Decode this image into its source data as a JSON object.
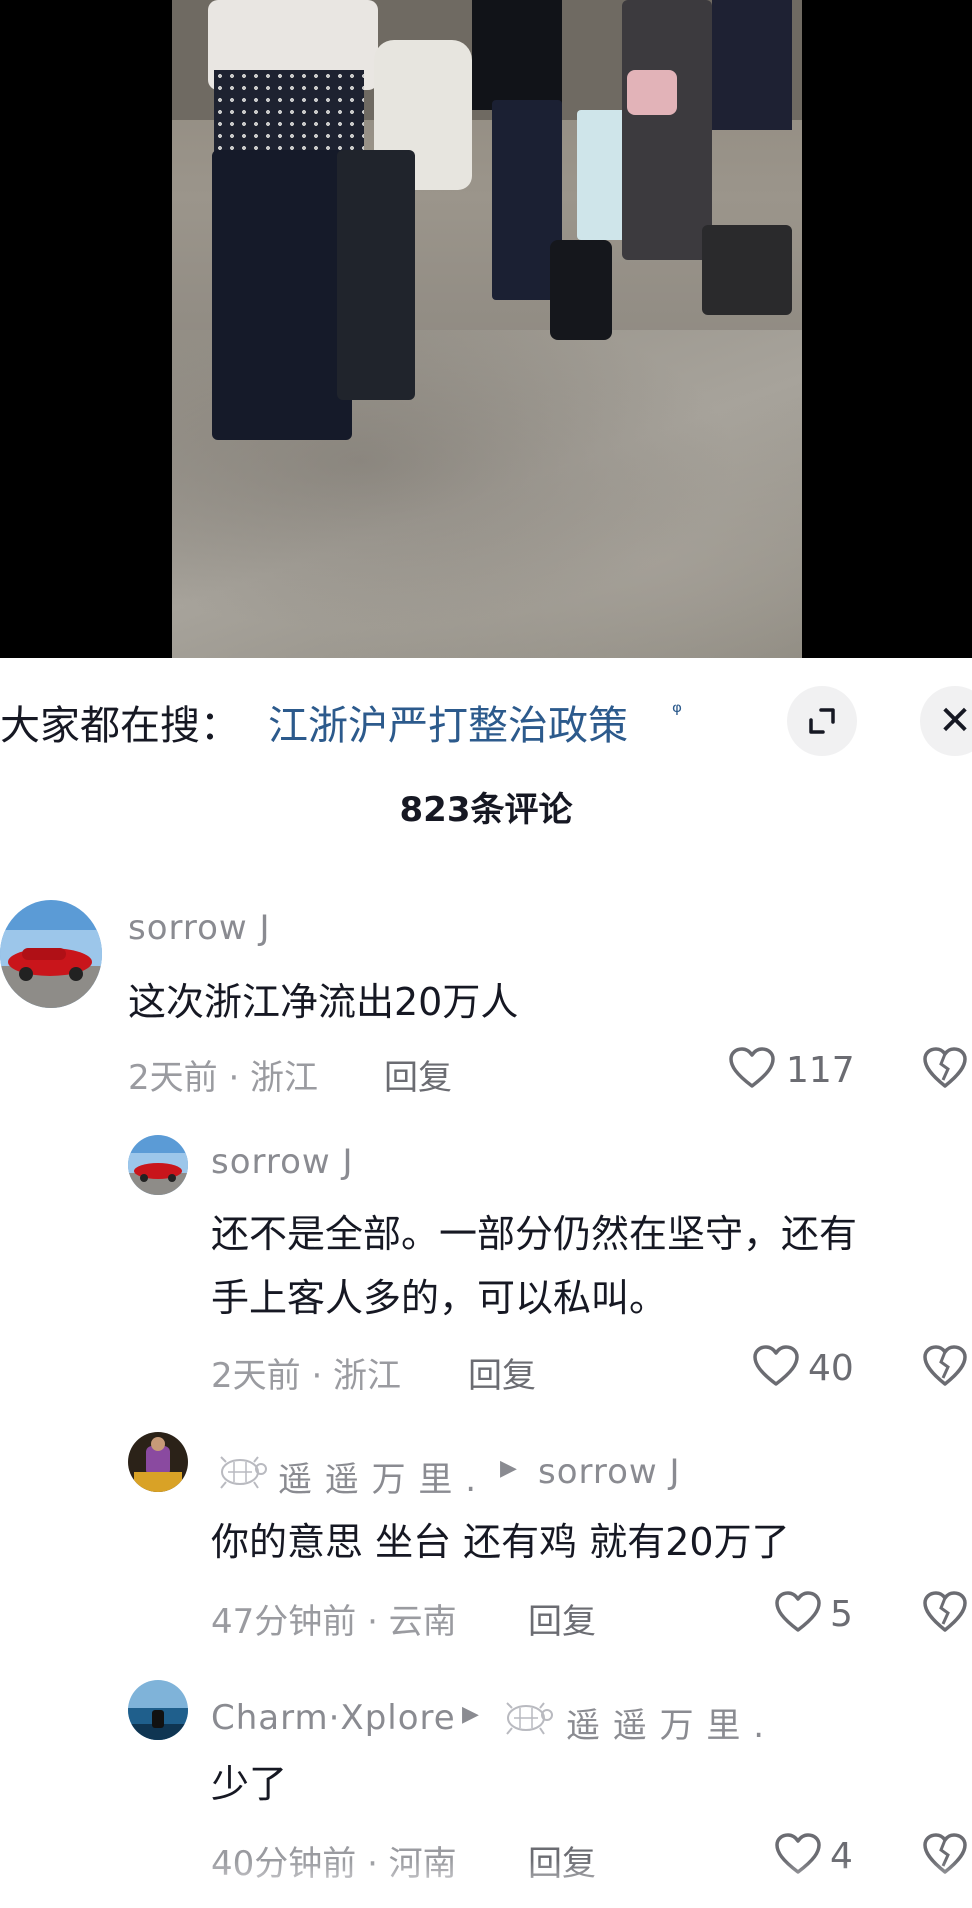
{
  "search": {
    "prefix": "大家都在搜：",
    "term": "江浙沪严打整治政策",
    "search_glyph": "ᵠ"
  },
  "panel": {
    "expand_icon": "expand-icon",
    "close_label": "✕",
    "comment_count": "823条评论"
  },
  "comments": [
    {
      "user": "sorrow  J",
      "text_lines": [
        "这次浙江净流出20万人"
      ],
      "time": "2天前 · 浙江",
      "reply": "回复",
      "likes": "117"
    },
    {
      "user": "sorrow  J",
      "text_lines": [
        "还不是全部。一部分仍然在坚守，还有",
        "手上客人多的，可以私叫。"
      ],
      "time": "2天前 · 浙江",
      "reply": "回复",
      "likes": "40"
    },
    {
      "user": "遥 遥 万 里 .",
      "reply_to": "sorrow  J",
      "text_lines": [
        "你的意思  坐台  还有鸡  就有20万了"
      ],
      "time": "47分钟前 · 云南",
      "reply": "回复",
      "likes": "5"
    },
    {
      "user": "Charm·Xplore",
      "reply_to": "遥 遥 万 里 .",
      "text_lines": [
        "少了"
      ],
      "time": "40分钟前 · 河南",
      "reply": "回复",
      "likes": "4"
    }
  ],
  "colors": {
    "link_blue": "#2c5a8c",
    "muted_text": "#8a8b91",
    "primary_text": "#161823"
  }
}
